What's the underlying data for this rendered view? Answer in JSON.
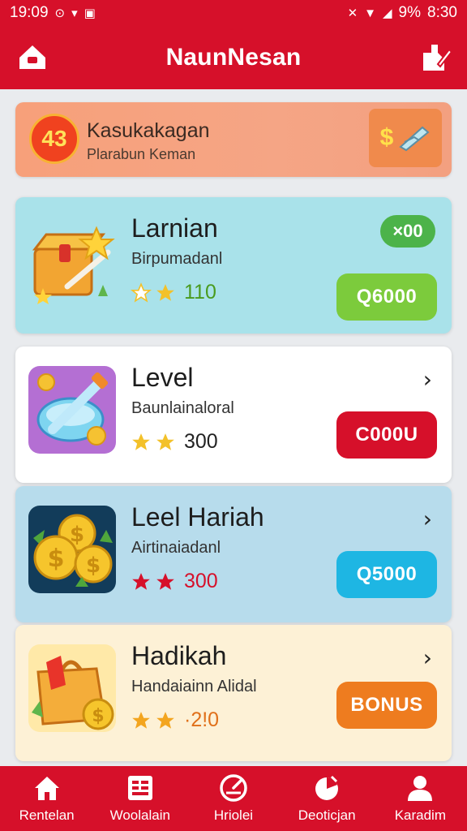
{
  "status_bar": {
    "time": "19:09",
    "battery": "9%",
    "clock_right": "8:30"
  },
  "header": {
    "title": "NaunNesan",
    "left_icon": "home-icon",
    "right_icon": "edit-icon"
  },
  "promo": {
    "badge": "43",
    "title": "Kasukakagan",
    "subtitle": "Plarabun Keman",
    "dollar": "$"
  },
  "cards": [
    {
      "title": "Larnian",
      "subtitle": "Birpumadanl",
      "points": "110",
      "button": "Q6000",
      "badge": "×00",
      "icon": "treasure-box-icon",
      "background": "#a9e2ea",
      "button_color": "#7ccb3c",
      "star_color": "#f3c12a",
      "points_color": "#4a9b1e"
    },
    {
      "title": "Level",
      "subtitle": "Baunlainaloral",
      "points": "300",
      "button": "C000U",
      "chevron": "›",
      "icon": "potion-icon",
      "background": "#ffffff",
      "button_color": "#d6102a",
      "star_color": "#f3c12a",
      "points_color": "#222222"
    },
    {
      "title": "Leel Hariah",
      "subtitle": "Airtinaiadanl",
      "points": "300",
      "button": "Q5000",
      "chevron": "›",
      "icon": "coins-icon",
      "background": "#b7dcec",
      "button_color": "#1eb6e3",
      "star_color": "#d6102a",
      "points_color": "#d6102a"
    },
    {
      "title": "Hadikah",
      "subtitle": "Handaiainn Alidal",
      "points": "·2!0",
      "button": "BONUS",
      "chevron": "›",
      "icon": "bonus-bag-icon",
      "background": "#fdf1d6",
      "button_color": "#ee7c1f",
      "star_color": "#f3a51f",
      "points_color": "#e0701a"
    }
  ],
  "nav": [
    {
      "label": "Rentelan",
      "icon": "home-icon"
    },
    {
      "label": "Woolalain",
      "icon": "list-icon"
    },
    {
      "label": "Hriolei",
      "icon": "gauge-icon"
    },
    {
      "label": "Deoticjan",
      "icon": "chart-icon"
    },
    {
      "label": "Karadim",
      "icon": "user-icon"
    }
  ]
}
